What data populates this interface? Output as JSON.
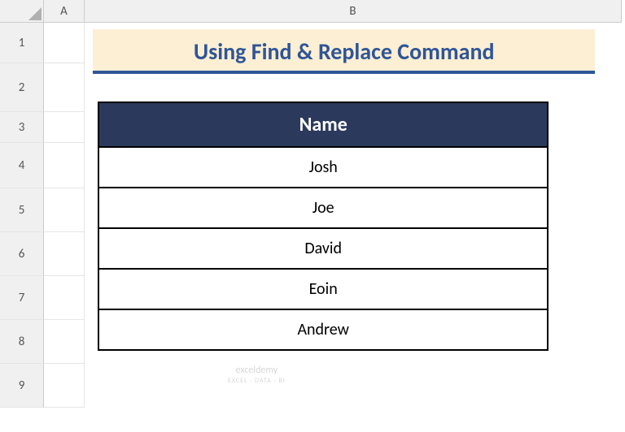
{
  "columns": [
    "A",
    "B"
  ],
  "rows": [
    "1",
    "2",
    "3",
    "4",
    "5",
    "6",
    "7",
    "8",
    "9"
  ],
  "title": "Using Find & Replace Command",
  "table": {
    "header": "Name",
    "data": [
      "Josh",
      "Joe",
      "David",
      "Eoin",
      "Andrew"
    ]
  },
  "watermark": {
    "main": "exceldemy",
    "sub": "EXCEL · DATA · BI"
  }
}
